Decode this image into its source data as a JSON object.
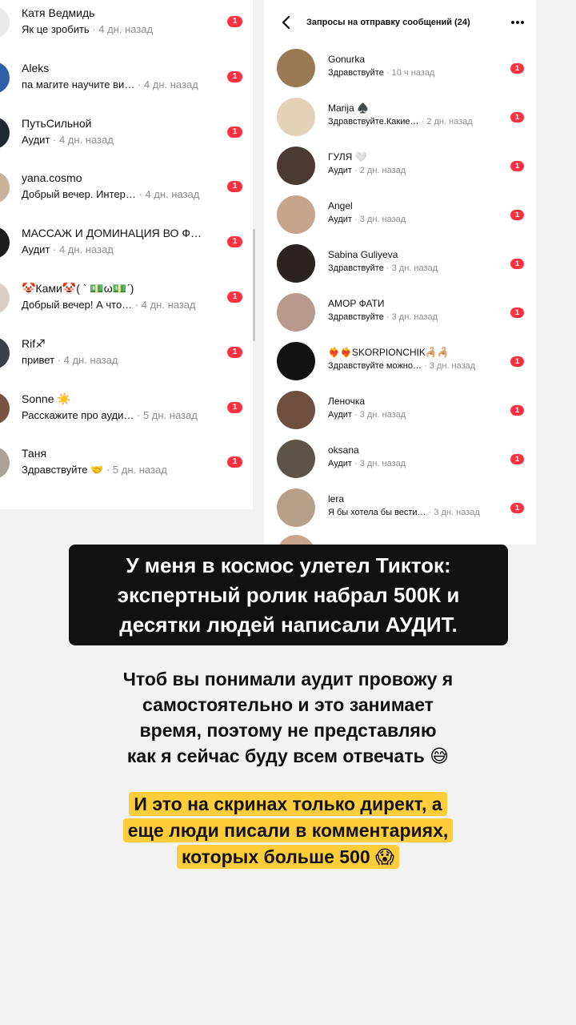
{
  "left_list": [
    {
      "name": "Катя Ведмидь",
      "preview": "Як це зробить",
      "time": "4 дн. назад",
      "badge": "1",
      "avatar": "#e9e9e9"
    },
    {
      "name": "Aleks",
      "preview": "па магите научите ви…",
      "time": "4 дн. назад",
      "badge": "1",
      "avatar": "#2f5fa6"
    },
    {
      "name": "ПутьСильной",
      "preview": "Аудит",
      "time": "4 дн. назад",
      "badge": "1",
      "avatar": "#222831"
    },
    {
      "name": "yana.cosmo",
      "preview": "Добрый вечер. Интер…",
      "time": "4 дн. назад",
      "badge": "1",
      "avatar": "#c9b19a"
    },
    {
      "name": "МАССАЖ И ДОМИНАЦИЯ ВО Ф…",
      "preview": "Аудит",
      "time": "4 дн. назад",
      "badge": "1",
      "avatar": "#1d1d1d"
    },
    {
      "name": "🤡Ками🤡( ˋ 💵ω💵ˊ)",
      "preview": "Добрый вечер! А что…",
      "time": "4 дн. назад",
      "badge": "1",
      "avatar": "#d7cfc7"
    },
    {
      "name": "Rif♐",
      "preview": "привет",
      "time": "4 дн. назад",
      "badge": "1",
      "avatar": "#3a3f4a"
    },
    {
      "name": "Sonne ☀️",
      "preview": "Расскажите про ауди…",
      "time": "5 дн. назад",
      "badge": "1",
      "avatar": "#7a5240"
    },
    {
      "name": "Таня",
      "preview": "Здравствуйте 🤝",
      "time": "5 дн. назад",
      "badge": "1",
      "avatar": "#a8a29b"
    }
  ],
  "right_header": {
    "title": "Запросы на отправку сообщений (24)"
  },
  "right_list": [
    {
      "name": "Gonurka",
      "preview": "Здравствуйте",
      "time": "10 ч назад",
      "badge": "1",
      "avatar": "#9a7a55"
    },
    {
      "name": "Marija ♠️",
      "preview": "Здравствуйте.Какие…",
      "time": "2 дн. назад",
      "badge": "1",
      "avatar": "#e3d2b8"
    },
    {
      "name": "ГУЛЯ 🤍",
      "preview": "Аудит",
      "time": "2 дн. назад",
      "badge": "1",
      "avatar": "#4a3a33"
    },
    {
      "name": "Angel",
      "preview": "Аудит",
      "time": "3 дн. назад",
      "badge": "1",
      "avatar": "#c7a48e"
    },
    {
      "name": "Sabina Guliyeva",
      "preview": "Здравствуйте",
      "time": "3 дн. назад",
      "badge": "1",
      "avatar": "#2b2321"
    },
    {
      "name": "АМОР ФАТИ",
      "preview": "Здравствуйте",
      "time": "3 дн. назад",
      "badge": "1",
      "avatar": "#b79a8c"
    },
    {
      "name": "❤️‍🔥❤️‍🔥SKORPIONCHIK🦂🦂",
      "preview": "Здравствуйте можно…",
      "time": "3 дн. назад",
      "badge": "1",
      "avatar": "#121212"
    },
    {
      "name": "Леночка",
      "preview": "Аудит",
      "time": "3 дн. назад",
      "badge": "1",
      "avatar": "#6e4e3e"
    },
    {
      "name": "oksana",
      "preview": "Аудит",
      "time": "3 дн. назад",
      "badge": "1",
      "avatar": "#5d5449"
    },
    {
      "name": "lera",
      "preview": "Я бы хотела бы вести…",
      "time": "3 дн. назад",
      "badge": "1",
      "avatar": "#b6a089"
    }
  ],
  "captions": {
    "c1": [
      "У меня в космос улетел Тикток:",
      "экспертный ролик набрал 500К и",
      "десятки людей написали АУДИТ."
    ],
    "c2": [
      "Чтоб вы понимали аудит провожу я",
      "самостоятельно и это занимает",
      "время, поэтому не представляю",
      "как я сейчас буду всем отвечать 😅"
    ],
    "c3": [
      "И это на скринах только директ, а",
      "еще люди писали в комментариях,",
      "которых больше 500 😱"
    ]
  },
  "colors": {
    "badge": "#ff3040",
    "caption_dark_bg": "#111111",
    "highlight": "#ffcd3a",
    "muted_text": "#8e8e8e"
  }
}
